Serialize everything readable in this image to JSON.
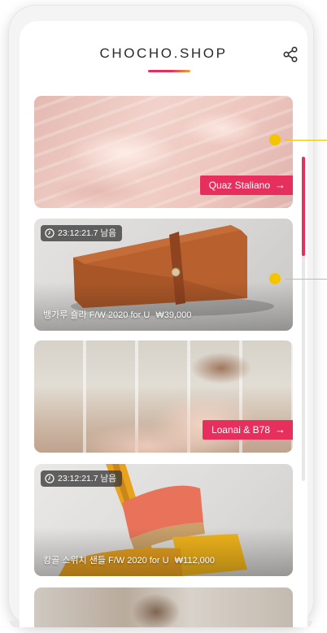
{
  "header": {
    "title": "CHOCHO.SHOP",
    "share_icon": "share-icon"
  },
  "cards": [
    {
      "kind": "brand",
      "label": "Quaz Staliano",
      "image": "pink-tulle-dress-photo"
    },
    {
      "kind": "product",
      "timer": "23:12:21.7 남음",
      "name": "뱅가루 숄라 F/W 2020 for U",
      "price": "₩39,000",
      "image": "brown-clutch-bag-photo"
    },
    {
      "kind": "brand",
      "label": "Loanai & B78",
      "image": "woman-in-pink-dress-photo"
    },
    {
      "kind": "product",
      "timer": "23:12:21.7 남음",
      "name": "캉골 스위치 샌들 F/W 2020 for U",
      "price": "₩112,000",
      "image": "orange-high-heel-sandal-photo"
    }
  ],
  "icons": {
    "arrow": "→",
    "clock": "clock-icon"
  },
  "colors": {
    "accent": "#e72f5d",
    "marker": "#f5c400",
    "title": "#2a2a2a"
  }
}
